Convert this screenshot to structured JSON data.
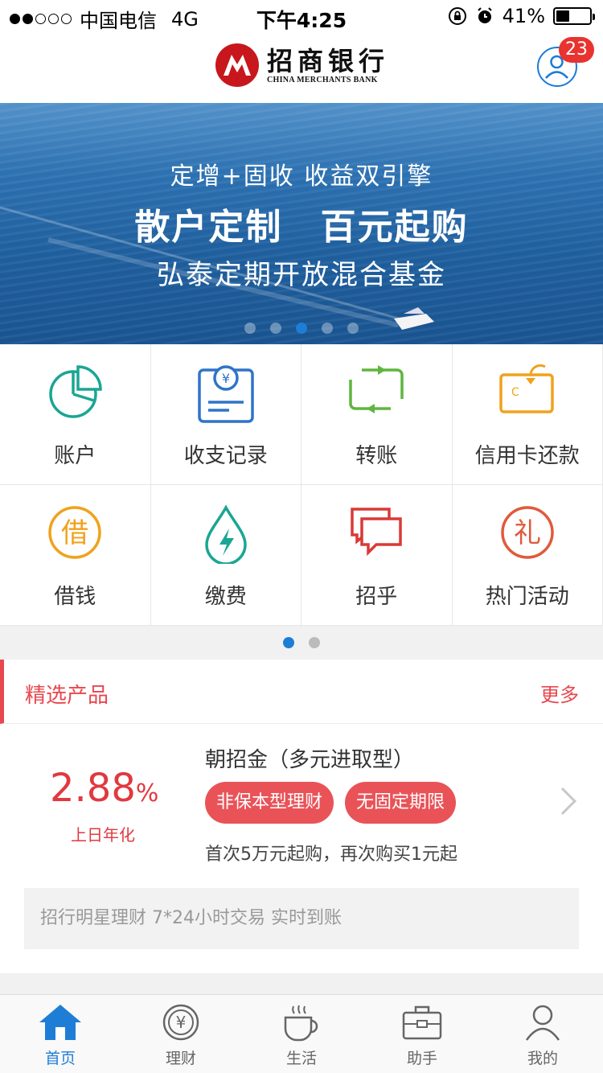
{
  "status_bar": {
    "carrier": "中国电信",
    "network": "4G",
    "time": "下午4:25",
    "battery": "41%",
    "battery_level": 0.41
  },
  "header": {
    "logo_cn": "招商银行",
    "logo_en": "CHINA MERCHANTS BANK",
    "notification_count": "23"
  },
  "banner": {
    "line1": "定增+固收  收益双引擎",
    "line2": "散户定制 百元起购",
    "line3": "弘泰定期开放混合基金",
    "slide_count": 5,
    "active_slide": 3
  },
  "menu": {
    "items": [
      {
        "label": "账户",
        "icon": "pie-chart-icon"
      },
      {
        "label": "收支记录",
        "icon": "receipt-yen-icon"
      },
      {
        "label": "转账",
        "icon": "transfer-icon"
      },
      {
        "label": "信用卡还款",
        "icon": "credit-card-icon"
      },
      {
        "label": "借钱",
        "icon": "borrow-icon"
      },
      {
        "label": "缴费",
        "icon": "water-drop-bolt-icon"
      },
      {
        "label": "招乎",
        "icon": "chat-bubbles-icon"
      },
      {
        "label": "热门活动",
        "icon": "gift-icon"
      }
    ],
    "page_count": 2,
    "active_page": 1
  },
  "featured": {
    "title": "精选产品",
    "more": "更多",
    "product": {
      "rate": "2.88",
      "rate_unit": "%",
      "rate_label": "上日年化",
      "name": "朝招金（多元进取型）",
      "tags": [
        "非保本型理财",
        "无固定期限"
      ],
      "description": "首次5万元起购，再次购买1元起"
    },
    "promo": "招行明星理财 7*24小时交易 实时到账"
  },
  "tabbar": {
    "items": [
      {
        "label": "首页",
        "icon": "home-icon",
        "active": true
      },
      {
        "label": "理财",
        "icon": "yen-coin-icon",
        "active": false
      },
      {
        "label": "生活",
        "icon": "coffee-cup-icon",
        "active": false
      },
      {
        "label": "助手",
        "icon": "briefcase-icon",
        "active": false
      },
      {
        "label": "我的",
        "icon": "person-icon",
        "active": false
      }
    ]
  },
  "colors": {
    "brand_red": "#c8161d",
    "accent_blue": "#1e7ed6",
    "highlight_red": "#e8474e"
  }
}
